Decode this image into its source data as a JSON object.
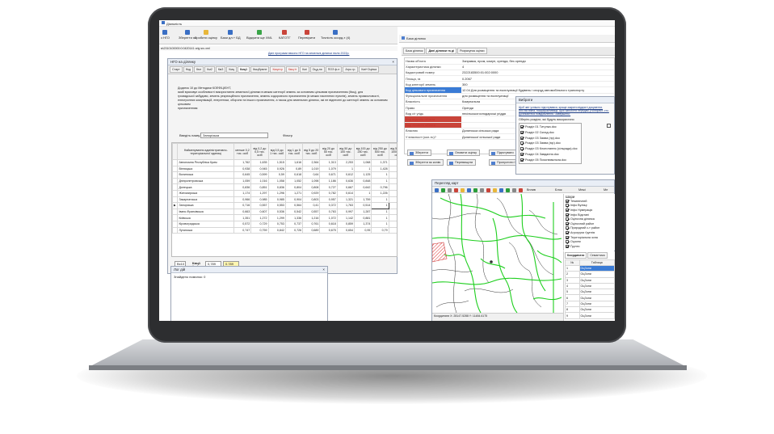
{
  "app": {
    "title": "Діяльність",
    "menu_buttons": [
      "з НГО",
      "Зберегти як",
      "Зробити оцінку",
      "Бази дл.+ БД",
      "Відкрити ще XML",
      "КАТОТГ",
      "Перевірити",
      "Точність коорд-т (4)"
    ],
    "sub_caption": "Дані програми ввсоно НГО на земельні ділянки після 2022р.",
    "file_caption": "м\\2310100000:0:0420141 orig src.xml"
  },
  "ngo_window": {
    "title": "НГО на ділянку",
    "tabs": [
      {
        "label": "Старт",
        "style": ""
      },
      {
        "label": "Нкд",
        "style": ""
      },
      {
        "label": "Кмт",
        "style": ""
      },
      {
        "label": "Км2",
        "style": ""
      },
      {
        "label": "Км3",
        "style": ""
      },
      {
        "label": "Кмц",
        "style": ""
      },
      {
        "label": "Кмц1",
        "style": "act"
      },
      {
        "label": "Кмцбрюне",
        "style": ""
      },
      {
        "label": "Кмцеxp",
        "style": "red"
      },
      {
        "label": "Кмцгіт",
        "style": "red"
      },
      {
        "label": "Кмі",
        "style": ""
      },
      {
        "label": "Оцд-ня",
        "style": ""
      },
      {
        "label": "ПОЗ ф-н",
        "style": ""
      },
      {
        "label": "Агро гр.",
        "style": ""
      },
      {
        "label": "Кмі+Оцінка",
        "style": ""
      }
    ],
    "description": [
      "Додаток 10 до Методики КОЕФІЦІЄНТ,",
      "який враховує особливості використання земельної ділянки в межах категорії земель за основним цільовим призначенням (Кмц), для",
      "громадської забудови, земель рекреаційного призначення, земель оздоровчого призначення (в межах населених пунктів), земель промисловості,",
      "електронних комунікацій, енергетики, оборони та іншого призначення, а також для земельних ділянок, які не віднесені до категорії земель за основним цільовим",
      "призначенням"
    ],
    "region_label": "Введіть назву",
    "region_value": "Запорізька",
    "filter_label": "Фільтр",
    "col_headers": [
      "Найменування адміністративно-територіальної одиниці",
      "менше 0,2 тис. осіб",
      "від 0,2 до 0,5 тис. осіб",
      "від 0,5 до 1 тис. осіб",
      "від 1 до 5 тис. осіб",
      "від 5 до 20 тис. осіб",
      "від 20 до 50 тис. осіб",
      "від 50 до 100 тис. осіб",
      "від 100 до 250 тис. осіб",
      "від 250 до 500 тис. осіб",
      "від 500 до 1000 тис. осіб"
    ],
    "rows": [
      [
        "Автономна Республіка Крим",
        "1,762",
        "1,635",
        "1,515",
        "1,616",
        "2,364",
        "1,313",
        "2,253",
        "1,068",
        "1,371",
        "1"
      ],
      [
        "Вінницька",
        "0,938",
        "0,945",
        "0,926",
        "0,89",
        "1,019",
        "1,079",
        "1",
        "1",
        "1,428",
        "1"
      ],
      [
        "Волинська",
        "0,645",
        "0,599",
        "0,59",
        "0,618",
        "0,64",
        "0,671",
        "0,612",
        "1,125",
        "1",
        "1"
      ],
      [
        "Дніпропетровська",
        "1,059",
        "1,016",
        "1,058",
        "1,052",
        "1,098",
        "1,186",
        "0,636",
        "0,848",
        "1",
        "0,9"
      ],
      [
        "Донецька",
        "0,836",
        "0,851",
        "0,836",
        "0,804",
        "0,808",
        "0,727",
        "0,667",
        "0,642",
        "0,796",
        "0,8"
      ],
      [
        "Житомирська",
        "1,174",
        "1,297",
        "1,296",
        "1,271",
        "0,929",
        "0,782",
        "0,614",
        "1",
        "1,226",
        "1"
      ],
      [
        "Закарпатська",
        "0,966",
        "0,985",
        "0,985",
        "0,904",
        "0,803",
        "0,957",
        "1,321",
        "1,759",
        "1",
        "1"
      ],
      [
        "Запорізька",
        "0,716",
        "0,557",
        "0,553",
        "0,564",
        "0,41",
        "0,372",
        "1,763",
        "0,514",
        "1",
        "0,789"
      ],
      [
        "Івано-Франківська",
        "0,663",
        "0,607",
        "0,536",
        "0,542",
        "0,557",
        "0,763",
        "0,997",
        "1,287",
        "1",
        "1"
      ],
      [
        "Київська",
        "1,351",
        "1,272",
        "1,299",
        "1,336",
        "1,216",
        "1,072",
        "1,142",
        "0,881",
        "1",
        "1"
      ],
      [
        "Кіровоградська",
        "0,572",
        "0,729",
        "0,753",
        "0,737",
        "0,761",
        "0,618",
        "0,859",
        "1,374",
        "1",
        "1"
      ],
      [
        "Луганська",
        "0,747",
        "0,759",
        "0,842",
        "0,726",
        "0,689",
        "0,675",
        "0,654",
        "0,95",
        "0,79",
        "1"
      ]
    ],
    "selected_row": 7,
    "bottom_a": "Вх10",
    "bottom_label": "Кмц1",
    "bottom_sub": "Кмц1",
    "bottom_val1": "0,789",
    "bottom_val2": "0.789"
  },
  "log_window": {
    "title": "Лог дій",
    "text": "Знайдено помилок: 0"
  },
  "right_panel": {
    "tabs": [
      "База ділянок",
      "Дані ділянки та ді",
      "Розрахунок оцінки"
    ],
    "window_title": "База ділянок",
    "props": [
      {
        "k": "Назва об'єкта",
        "v": "Заправка, пром, комун, оренда, без оренди",
        "st": "",
        "vc": "#222"
      },
      {
        "k": "Характеристика ділянки",
        "v": "4",
        "st": "",
        "vc": "#222"
      },
      {
        "k": "Кадастровий номер",
        "v": "2322183500:01:002:0000",
        "st": "",
        "vc": "#222"
      },
      {
        "k": "Площа, га",
        "v": "0.2067",
        "st": "",
        "vc": "#222"
      },
      {
        "k": "Код категорії земель",
        "v": "300",
        "st": "",
        "vc": "#222"
      },
      {
        "k": "Код цільового призначення",
        "v": "12.04 Для розміщення та експлуатації будівель і споруд автомобільного транспорту",
        "st": "sel",
        "vc": "#222"
      },
      {
        "k": "Функціональне призначення",
        "v": "для розміщення та експлуатації",
        "st": "",
        "vc": "#222"
      },
      {
        "k": "Власність",
        "v": "Комунальна",
        "st": "",
        "vc": "#222"
      },
      {
        "k": "Право",
        "v": "Оренди",
        "st": "",
        "vc": "#222"
      },
      {
        "k": "Вид с/г угідь",
        "v": "несільськогосподарські угіддя",
        "st": "",
        "vc": "#222"
      },
      {
        "k": "Вид водного об'єкта",
        "v": "",
        "st": "red",
        "vc": "#222"
      },
      {
        "k": "Вид лісового об'єкта",
        "v": "",
        "st": "red",
        "vc": "#222"
      },
      {
        "k": "Власник",
        "v": "Долинська сільська рада",
        "st": "",
        "vc": "#222"
      },
      {
        "k": "У власності (кол-ть)?",
        "v": "Долинської сільської ради",
        "st": "",
        "vc": "#222"
      }
    ],
    "buttons": [
      "Зберегти",
      "Оновити оцінку",
      "Підготувати",
      "Зберегти як копію",
      "Перевищити",
      "Пропустити ОТГ"
    ]
  },
  "select_popup": {
    "title": "Вибрати",
    "note": [
      "Щоб звіт успішно підготувався, краще закрити відкриті документи.",
      "Або всі вікна, пошуку/активації, щоб запобігти передачі у конфлікт, сто.",
      "Дочекайтеся повідомлення \"Завершено\""
    ],
    "prompt": "Оберіть розділи, які будуть використано",
    "items": [
      "Розділ 01 Титулка.doc",
      "Розділ 02 Склад.doc",
      "Розділ 03 Заява (пр).doc",
      "Розділ 03 Заява (юр).doc",
      "Розділ 03 Клопотання (сільрада).doc",
      "Розділ 04 Завдання.doc",
      "Розділ 05 Пояснювальна.doc"
    ]
  },
  "map_window": {
    "title": "Перегляд карт",
    "layers_label": "Шари",
    "layers": [
      "Тематичний",
      "Інфо Вулиці",
      "Інфо Нумерація",
      "Інфо Відстані",
      "Оціночна ділянка",
      "Оціночний район",
      "Природний с-т район",
      "Агрогрупи ґрунтів",
      "Територіальна зона",
      "Оцзони",
      "Ґрунти"
    ],
    "coord_tabs": [
      "Координати",
      "Семантика"
    ],
    "coord_cols": [
      "№",
      "Таблиця"
    ],
    "coord_rows": [
      "1",
      "2",
      "3",
      "4",
      "5",
      "6",
      "7",
      "8",
      "9"
    ],
    "coord_value": "ОцЗони",
    "status": "Координати  X: 28147.5288  Y: 11484.6175",
    "toolbar_labels": [
      "Вплив",
      "Блок",
      "Межі",
      "Ме"
    ]
  }
}
